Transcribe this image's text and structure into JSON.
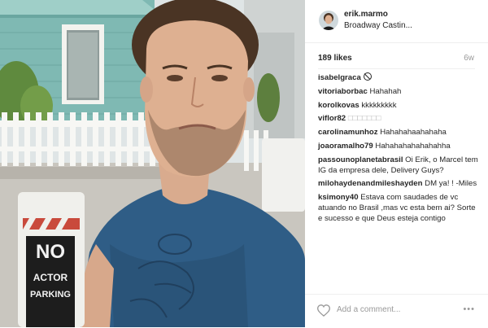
{
  "post": {
    "username": "erik.marmo",
    "location": "Broadway Castin...",
    "likes": "189 likes",
    "age": "6w"
  },
  "sign": {
    "line1": "NO",
    "line2": "ACTOR",
    "line3": "PARKING"
  },
  "comments": [
    {
      "user": "isabelgraca",
      "text": ""
    },
    {
      "user": "vitoriaborbac",
      "text": "Hahahah"
    },
    {
      "user": "korolkovas",
      "text": "kkkkkkkkk"
    },
    {
      "user": "viflor82",
      "text": "□□□□□□□"
    },
    {
      "user": "carolinamunhoz",
      "text": "Hahahahaahahaha"
    },
    {
      "user": "joaoramalho79",
      "text": "Hahahahahahahahha"
    },
    {
      "user": "passounoplanetabrasil",
      "text": "Oi Erik, o Marcel tem IG da empresa dele, Delivery Guys?"
    },
    {
      "user": "milohaydenandmileshayden",
      "text": "DM ya! ! -Miles"
    },
    {
      "user": "ksimony40",
      "text": "Estava com saudades de vc atuando no Brasil ,mas vc esta bem ai? Sorte e sucesso e que Deus esteja contigo"
    }
  ],
  "footer": {
    "add_comment_placeholder": "Add a comment...",
    "more_label": "•••"
  },
  "icons": {
    "like": "heart-icon",
    "more": "more-options-icon",
    "blocked": "blocked-icon"
  }
}
